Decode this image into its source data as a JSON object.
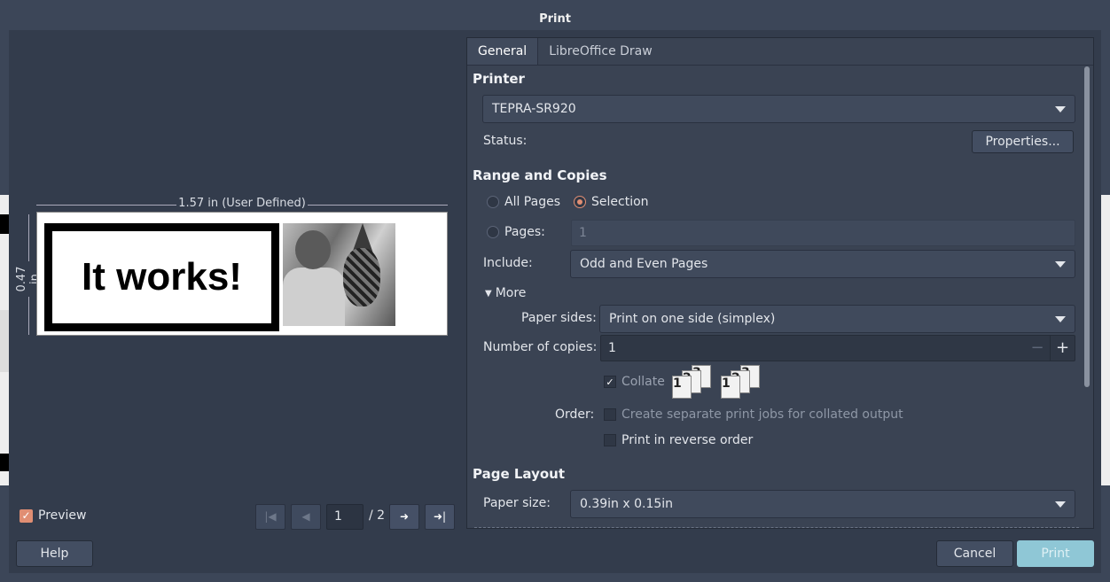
{
  "window": {
    "title": "Print"
  },
  "preview": {
    "width_label": "1.57 in (User Defined)",
    "height_label": "0.47 in",
    "label_text": "It works!",
    "preview_checkbox": "Preview",
    "page_current": "1",
    "page_total": "/ 2"
  },
  "tabs": [
    {
      "label": "General",
      "active": true
    },
    {
      "label": "LibreOffice Draw",
      "active": false
    }
  ],
  "printer": {
    "section": "Printer",
    "selected": "TEPRA-SR920",
    "status_label": "Status:",
    "properties_button": "Properties..."
  },
  "range": {
    "section": "Range and Copies",
    "all_pages": "All Pages",
    "selection": "Selection",
    "pages_label": "Pages:",
    "pages_value": "1",
    "include_label": "Include:",
    "include_value": "Odd and Even Pages",
    "more": "More",
    "paper_sides_label": "Paper sides:",
    "paper_sides_value": "Print on one side (simplex)",
    "copies_label": "Number of copies:",
    "copies_value": "1",
    "collate": "Collate",
    "order_label": "Order:",
    "separate_jobs": "Create separate print jobs for collated output",
    "reverse_order": "Print in reverse order"
  },
  "layout": {
    "section": "Page Layout",
    "paper_size_label": "Paper size:",
    "paper_size_value": "0.39in x 0.15in"
  },
  "buttons": {
    "help": "Help",
    "cancel": "Cancel",
    "print": "Print"
  },
  "colors": {
    "accent": "#e08e73",
    "print_button": "#8fc7d6",
    "background": "#333c4c"
  }
}
